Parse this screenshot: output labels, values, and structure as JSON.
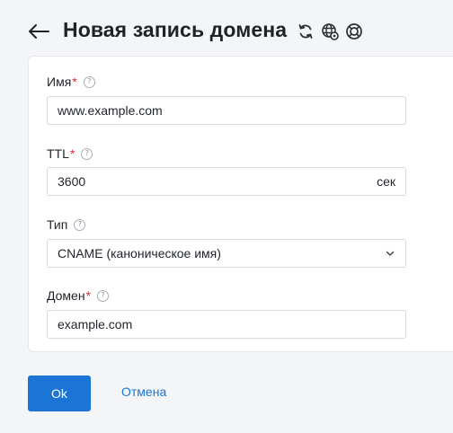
{
  "header": {
    "title": "Новая запись домена",
    "icons": [
      "back-arrow-icon",
      "refresh-icon",
      "globe-settings-icon",
      "lifebuoy-icon"
    ]
  },
  "form": {
    "name": {
      "label": "Имя",
      "required_mark": "*",
      "help": "?",
      "value": "www.example.com"
    },
    "ttl": {
      "label": "TTL",
      "required_mark": "*",
      "help": "?",
      "value": "3600",
      "suffix": "сек"
    },
    "type": {
      "label": "Тип",
      "help": "?",
      "value": "CNAME (каноническое имя)"
    },
    "domain": {
      "label": "Домен",
      "required_mark": "*",
      "help": "?",
      "value": "example.com"
    }
  },
  "actions": {
    "ok_label": "Ok",
    "cancel_label": "Отмена"
  },
  "colors": {
    "accent": "#1a75d6",
    "required": "#e0293b",
    "background": "#f4f5f7",
    "text": "#1f2329"
  }
}
